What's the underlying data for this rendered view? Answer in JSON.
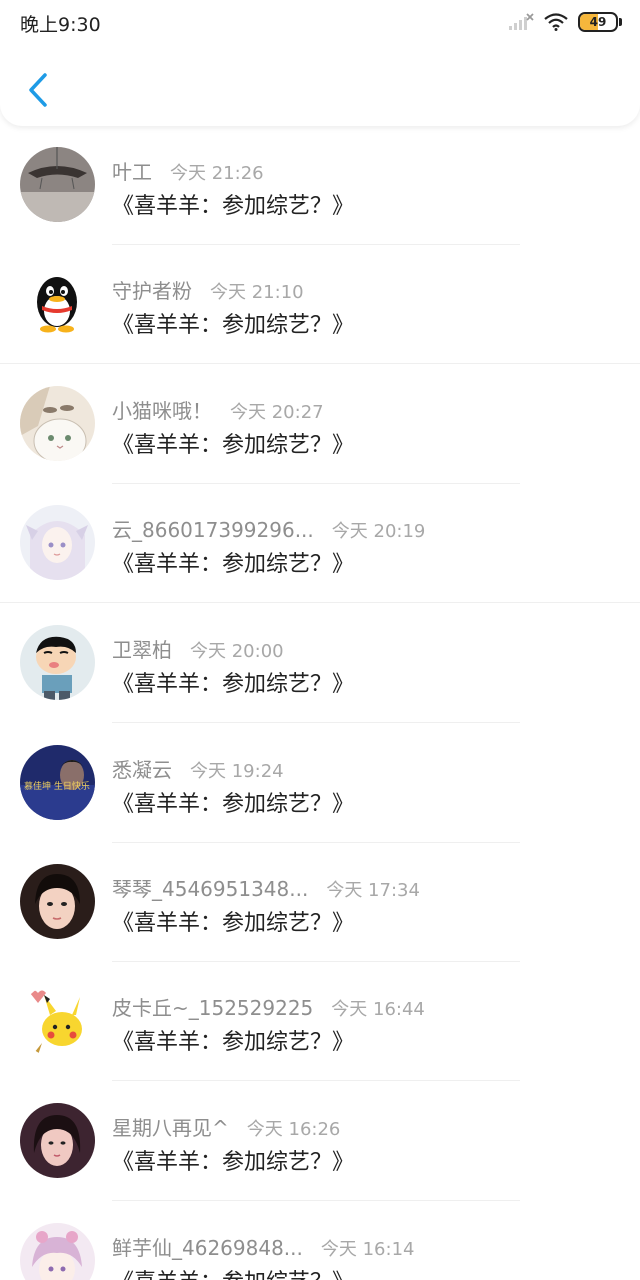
{
  "status": {
    "time": "晚上9:30",
    "battery": "49",
    "battery_level": 0.49,
    "battery_color": "#f6b73c"
  },
  "header": {
    "back_icon": "chevron-left-icon",
    "accent": "#1e9be6"
  },
  "items": [
    {
      "name": "叶工",
      "time": "今天 21:26",
      "message": "《喜羊羊：参加综艺？》"
    },
    {
      "name": "守护者粉",
      "time": "今天 21:10",
      "message": "《喜羊羊：参加综艺？》"
    },
    {
      "name": "小猫咪哦！",
      "time": "今天 20:27",
      "message": "《喜羊羊：参加综艺？》"
    },
    {
      "name": "云_866017399296...",
      "time": "今天 20:19",
      "message": "《喜羊羊：参加综艺？》"
    },
    {
      "name": "卫翠柏",
      "time": "今天 20:00",
      "message": "《喜羊羊：参加综艺？》"
    },
    {
      "name": "悉凝云",
      "time": "今天 19:24",
      "message": "《喜羊羊：参加综艺？》",
      "avatar_text": "慕佳坤 生日快乐"
    },
    {
      "name": "琴琴_4546951348...",
      "time": "今天 17:34",
      "message": "《喜羊羊：参加综艺？》"
    },
    {
      "name": "皮卡丘~_152529225",
      "time": "今天 16:44",
      "message": "《喜羊羊：参加综艺？》"
    },
    {
      "name": "星期八再见^",
      "time": "今天 16:26",
      "message": "《喜羊羊：参加综艺？》"
    },
    {
      "name": "鲜芋仙_46269848...",
      "time": "今天 16:14",
      "message": "《喜羊羊：参加综艺？》"
    }
  ]
}
